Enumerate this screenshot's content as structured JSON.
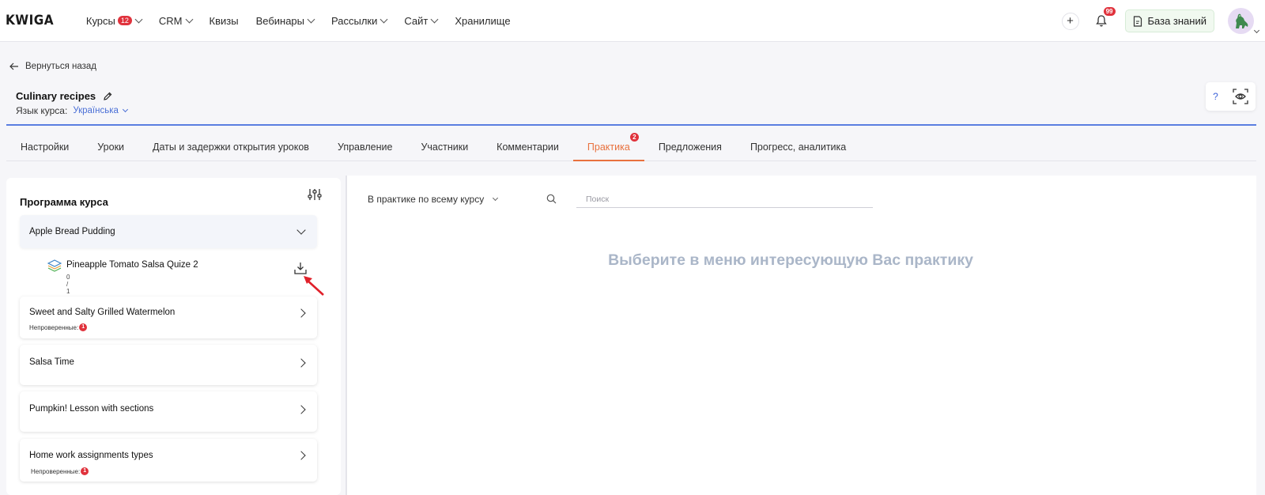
{
  "app": {
    "logo": "KWIGA"
  },
  "nav": {
    "items": [
      {
        "label": "Курсы",
        "badge": "12",
        "has_dropdown": true
      },
      {
        "label": "CRM",
        "has_dropdown": true
      },
      {
        "label": "Квизы",
        "has_dropdown": false
      },
      {
        "label": "Вебинары",
        "has_dropdown": true
      },
      {
        "label": "Рассылки",
        "has_dropdown": true
      },
      {
        "label": "Сайт",
        "has_dropdown": true
      },
      {
        "label": "Хранилище",
        "has_dropdown": false
      }
    ],
    "add_label": "+",
    "notifications_badge": "99",
    "knowledge_base_label": "База знаний"
  },
  "back_label": "Вернуться назад",
  "course": {
    "title": "Culinary recipes",
    "lang_label": "Язык курса:",
    "lang_value": "Українська",
    "help_label": "?"
  },
  "tabs": [
    {
      "label": "Настройки",
      "active": false
    },
    {
      "label": "Уроки",
      "active": false
    },
    {
      "label": "Даты и задержки открытия уроков",
      "active": false
    },
    {
      "label": "Управление",
      "active": false
    },
    {
      "label": "Участники",
      "active": false
    },
    {
      "label": "Комментарии",
      "active": false
    },
    {
      "label": "Практика",
      "active": true,
      "badge": "2"
    },
    {
      "label": "Предложения",
      "active": false
    },
    {
      "label": "Прогресс, аналитика",
      "active": false
    }
  ],
  "program": {
    "title": "Программа курса",
    "lessons": [
      {
        "name": "Apple Bread Pudding",
        "expanded": true
      },
      {
        "name": "Sweet and Salty Grilled Watermelon",
        "unchecked_label": "Непроверенные:",
        "unchecked_count": "1"
      },
      {
        "name": "Salsa Time"
      },
      {
        "name": "Pumpkin! Lesson with sections"
      },
      {
        "name": "Home work assignments types",
        "unchecked_label": "Непроверенные:",
        "unchecked_count": "1"
      }
    ],
    "sub_item": {
      "name": "Pineapple Tomato Salsa Quize 2",
      "count": "0 / 1"
    }
  },
  "practice": {
    "scope_label": "В практике по всему курсу",
    "search_placeholder": "Поиск",
    "empty_message": "Выберите в меню интересующую Вас практику"
  },
  "colors": {
    "accent_orange": "#e8713e",
    "badge_red": "#e0323c",
    "link_blue": "#4a6fd6",
    "empty_text": "#aab6c8"
  }
}
